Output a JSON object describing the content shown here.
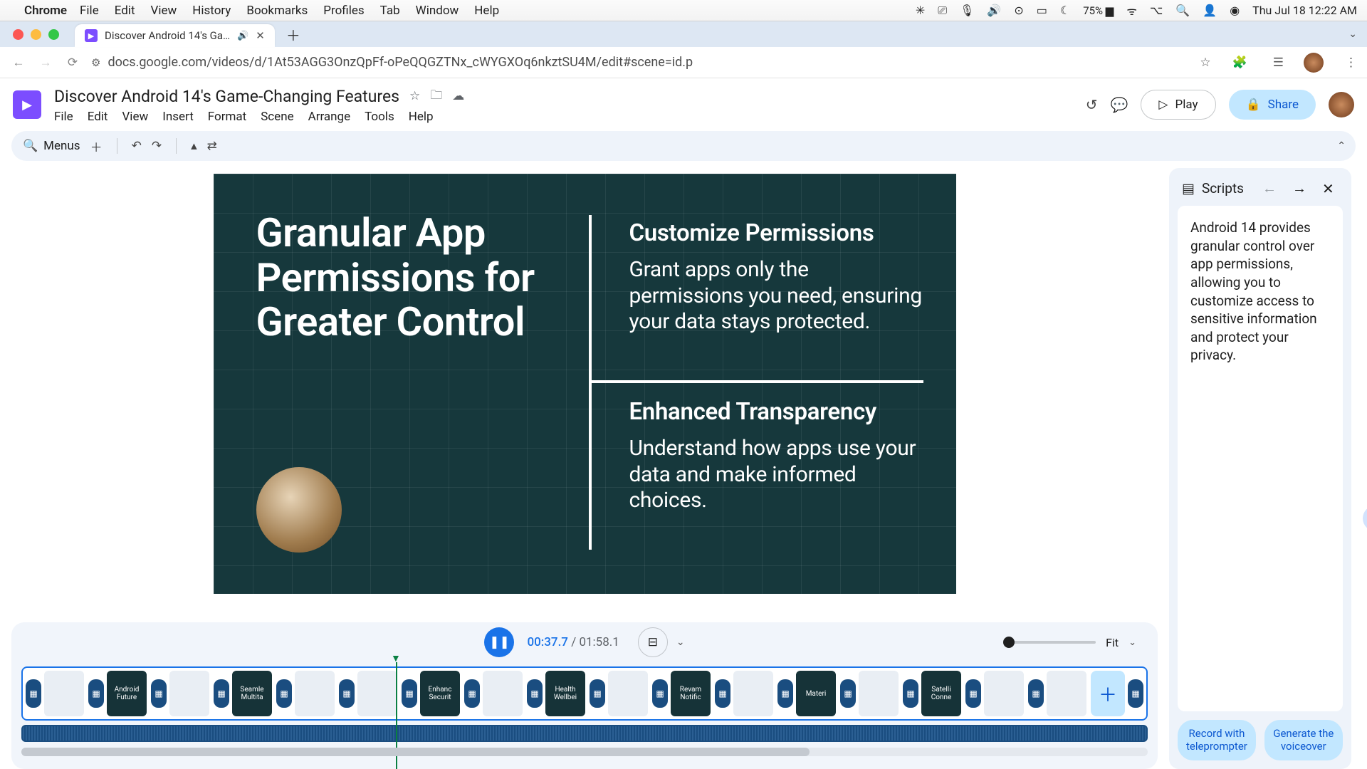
{
  "mac": {
    "app": "Chrome",
    "menus": [
      "File",
      "Edit",
      "View",
      "History",
      "Bookmarks",
      "Profiles",
      "Tab",
      "Window",
      "Help"
    ],
    "battery": "75%",
    "clock": "Thu Jul 18  12:22 AM"
  },
  "browser": {
    "tab_title": "Discover Android 14's Ga…",
    "url": "docs.google.com/videos/d/1At53AGG3OnzQpFf-oPeQQGZTNx_cWYGXOq6nkztSU4M/edit#scene=id.p"
  },
  "doc": {
    "title": "Discover Android 14's Game-Changing Features",
    "menus": [
      "File",
      "Edit",
      "View",
      "Insert",
      "Format",
      "Scene",
      "Arrange",
      "Tools",
      "Help"
    ],
    "play": "Play",
    "share": "Share"
  },
  "toolbar": {
    "menus": "Menus"
  },
  "slide": {
    "heading": "Granular App Permissions for Greater Control",
    "sec1_h": "Customize Permissions",
    "sec1_b": "Grant apps only the permissions you need, ensuring your data stays protected.",
    "sec2_h": "Enhanced Transparency",
    "sec2_b": "Understand how apps use your data and make informed choices."
  },
  "playback": {
    "current": "00:37.7",
    "sep": " / ",
    "total": "01:58.1",
    "zoom_label": "Fit"
  },
  "timeline": {
    "scenes": [
      "",
      "Android Future",
      "",
      "Seamle Multita",
      "",
      "",
      "Enhanc Securit",
      "",
      "Health Wellbei",
      "",
      "Revam Notific",
      "",
      "Materi",
      "",
      "Satelli Conne",
      "",
      ""
    ]
  },
  "scripts": {
    "title": "Scripts",
    "body": "Android 14 provides granular control over app permissions, allowing you to customize access to sensitive information and protect your privacy.",
    "record": "Record with teleprompter",
    "generate": "Generate the voiceover"
  }
}
